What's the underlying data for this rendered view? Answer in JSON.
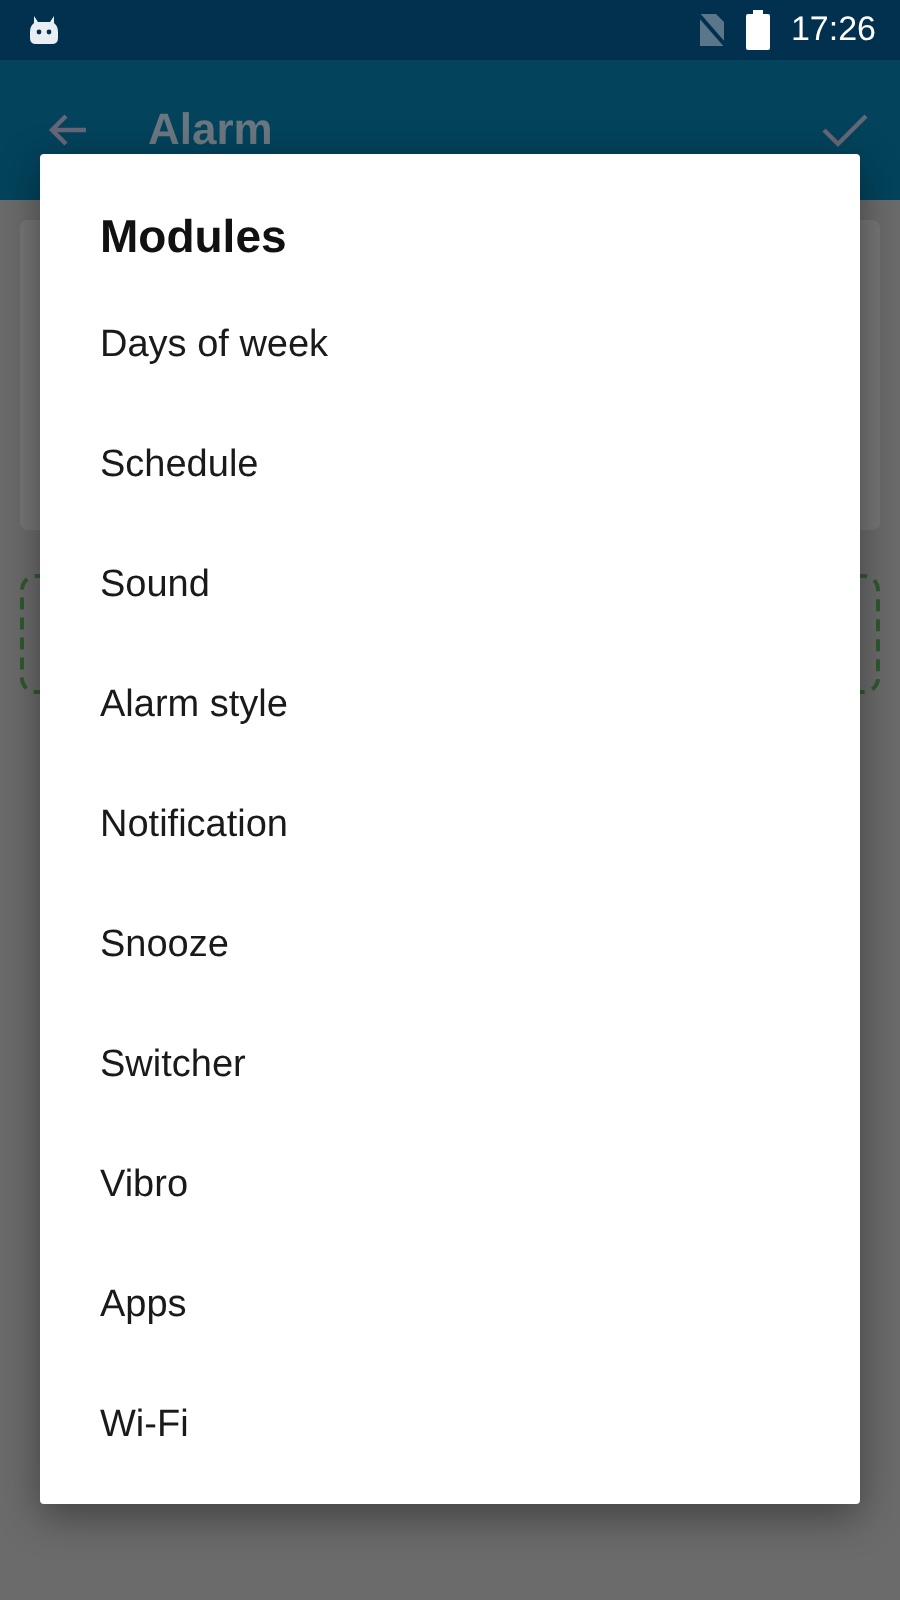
{
  "status_bar": {
    "time": "17:26"
  },
  "app_bar": {
    "title": "Alarm"
  },
  "dialog": {
    "title": "Modules",
    "items": [
      {
        "label": "Days of week"
      },
      {
        "label": "Schedule"
      },
      {
        "label": "Sound"
      },
      {
        "label": "Alarm style"
      },
      {
        "label": "Notification"
      },
      {
        "label": "Snooze"
      },
      {
        "label": "Switcher"
      },
      {
        "label": "Vibro"
      },
      {
        "label": "Apps"
      },
      {
        "label": "Wi-Fi"
      }
    ]
  }
}
